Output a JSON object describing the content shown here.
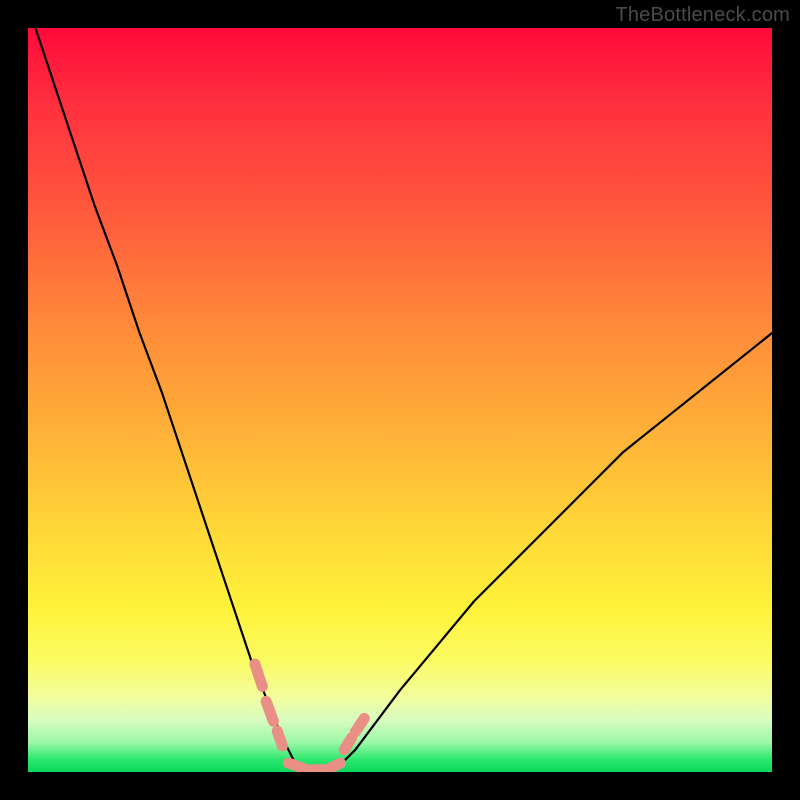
{
  "watermark": "TheBottleneck.com",
  "chart_data": {
    "type": "line",
    "title": "",
    "xlabel": "",
    "ylabel": "",
    "xlim": [
      0,
      100
    ],
    "ylim": [
      0,
      100
    ],
    "grid": false,
    "legend": false,
    "description": "Single black curve on a red→yellow→green vertical gradient. The curve descends steeply from the top-left, reaches a minimum near x≈36 at y≈0, stays flat along the bottom until x≈41, then ascends toward the top-right at a gentler slope ending near y≈59 at x=100. Salmon-colored dashed markers overlay the curve just above the minimum on both sides and along the flat trough.",
    "series": [
      {
        "name": "curve",
        "x": [
          0,
          3,
          6,
          9,
          12,
          15,
          18,
          21,
          24,
          27,
          30,
          32,
          34,
          35,
          36,
          37,
          38,
          39,
          40,
          41,
          42,
          44,
          47,
          50,
          55,
          60,
          65,
          70,
          75,
          80,
          85,
          90,
          95,
          100
        ],
        "y": [
          103,
          94,
          85,
          76,
          68,
          59,
          51,
          42,
          33,
          24,
          15,
          10,
          5,
          3,
          1,
          0,
          0,
          0,
          0,
          0,
          1,
          3,
          7,
          11,
          17,
          23,
          28,
          33,
          38,
          43,
          47,
          51,
          55,
          59
        ]
      }
    ],
    "markers": {
      "color": "#e98f86",
      "segments_x_y_pairs": [
        [
          [
            30.5,
            14.5
          ],
          [
            31.5,
            11.5
          ]
        ],
        [
          [
            32.0,
            9.5
          ],
          [
            33.0,
            6.8
          ]
        ],
        [
          [
            33.5,
            5.5
          ],
          [
            34.2,
            3.5
          ]
        ],
        [
          [
            42.5,
            3.0
          ],
          [
            43.5,
            4.6
          ]
        ],
        [
          [
            44.0,
            5.4
          ],
          [
            45.2,
            7.2
          ]
        ],
        [
          [
            35.0,
            1.2
          ],
          [
            37.0,
            0.5
          ]
        ],
        [
          [
            37.8,
            0.3
          ],
          [
            39.8,
            0.3
          ]
        ],
        [
          [
            40.4,
            0.4
          ],
          [
            42.0,
            1.2
          ]
        ]
      ]
    },
    "gradient_stops": [
      {
        "pos": 0.0,
        "color": "#ff0a3a"
      },
      {
        "pos": 0.25,
        "color": "#ff5a3c"
      },
      {
        "pos": 0.55,
        "color": "#ffb338"
      },
      {
        "pos": 0.78,
        "color": "#fff23a"
      },
      {
        "pos": 0.93,
        "color": "#d8fcc0"
      },
      {
        "pos": 1.0,
        "color": "#07d95c"
      }
    ]
  }
}
